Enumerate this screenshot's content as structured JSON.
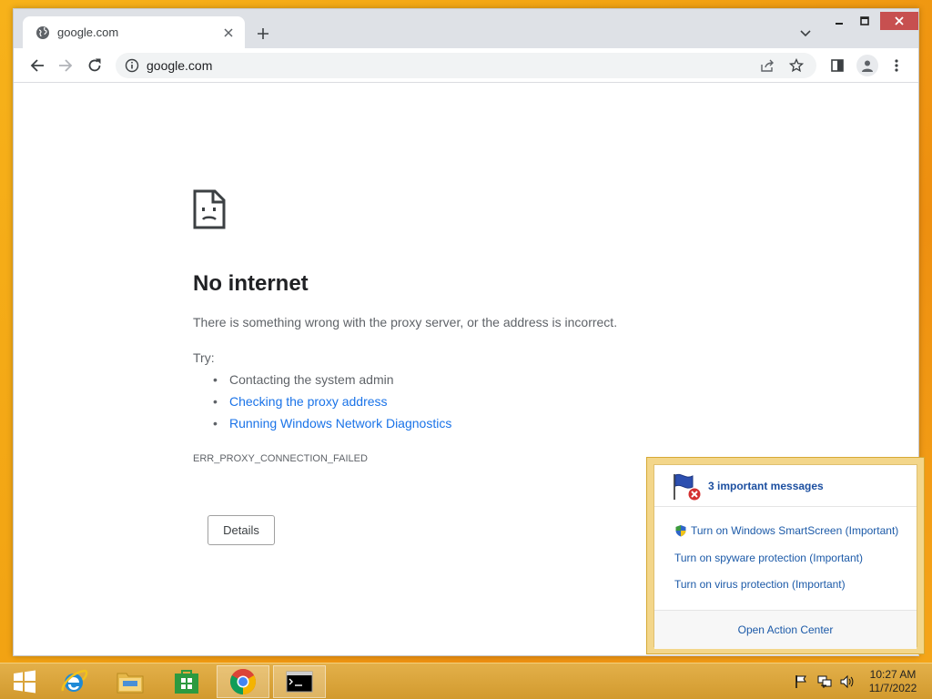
{
  "tab": {
    "title": "google.com"
  },
  "window_controls": {
    "minimize": "minimize",
    "maximize": "maximize",
    "close": "close"
  },
  "omnibox": {
    "url": "google.com"
  },
  "error_page": {
    "title": "No internet",
    "description": "There is something wrong with the proxy server, or the address is incorrect.",
    "try_label": "Try:",
    "suggestions": [
      {
        "text": "Contacting the system admin",
        "link": false
      },
      {
        "text": "Checking the proxy address",
        "link": true
      },
      {
        "text": "Running Windows Network Diagnostics",
        "link": true
      }
    ],
    "error_code": "ERR_PROXY_CONNECTION_FAILED",
    "details_button": "Details"
  },
  "action_center": {
    "title": "3 important messages",
    "items": [
      "Turn on Windows SmartScreen (Important)",
      "Turn on spyware protection (Important)",
      "Turn on virus protection (Important)"
    ],
    "footer_link": "Open Action Center"
  },
  "taskbar": {
    "apps": [
      "start-icon",
      "internet-explorer-icon",
      "file-explorer-icon",
      "store-icon",
      "chrome-icon",
      "command-prompt-icon"
    ],
    "clock": {
      "time": "10:27 AM",
      "date": "11/7/2022"
    }
  },
  "colors": {
    "desktop": "#f2a313",
    "link": "#1a73e8",
    "action_center_link": "#1c5aa8",
    "close_button": "#c75050"
  }
}
